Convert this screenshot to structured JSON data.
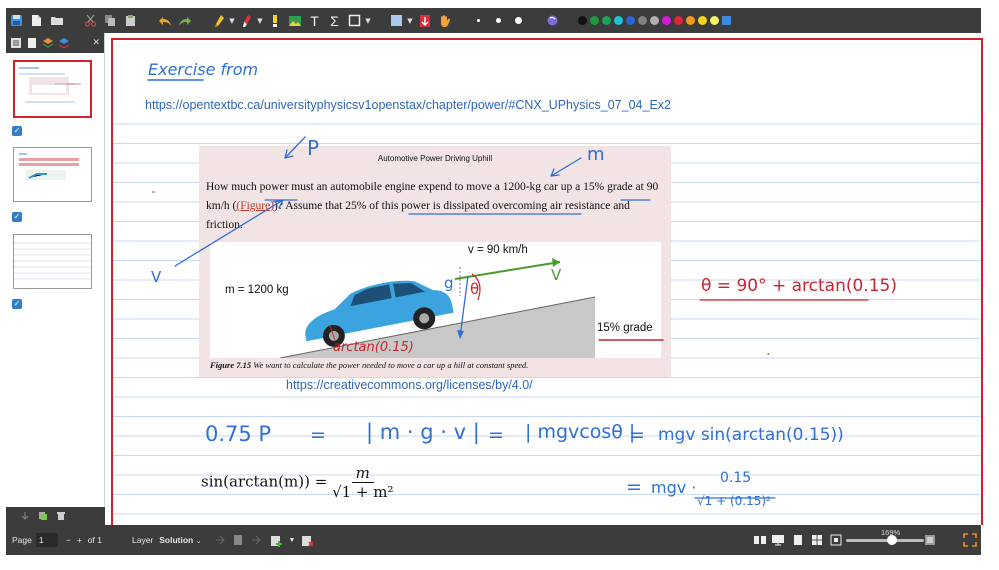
{
  "toolbar": {
    "icons": [
      "save-icon",
      "new-page-icon",
      "open-folder-icon",
      "cut-icon",
      "copy-icon",
      "paste-icon",
      "undo-icon",
      "redo-icon",
      "pen-icon",
      "highlighter-icon",
      "eraser-icon",
      "image-icon",
      "text-icon",
      "sigma-icon",
      "shape-icon",
      "fill-color-icon",
      "select-icon",
      "hand-icon",
      "dot-small-icon",
      "dot-medium-icon",
      "dot-large-icon",
      "eraser-round-icon"
    ],
    "text_tool_glyph": "T",
    "formula_tool_glyph": "Σ",
    "palette": [
      "#111111",
      "#1e9a3c",
      "#1aa35a",
      "#1ec3d8",
      "#2a67d6",
      "#808080",
      "#b0b0b0",
      "#d81ad8",
      "#e5243b",
      "#f29a1d",
      "#f5d51c",
      "#f6f06a",
      "#3c8be0"
    ]
  },
  "sidebar": {
    "pages": [
      {
        "label": "page-1",
        "selected": true,
        "checked": true
      },
      {
        "label": "page-2",
        "selected": false,
        "checked": true
      },
      {
        "label": "page-3",
        "selected": false,
        "checked": true
      }
    ]
  },
  "canvas": {
    "heading": "Exercise from",
    "source_url": "https://opentextbc.ca/universityphysicsv1openstax/chapter/power/#CNX_UPhysics_07_04_Ex2",
    "license_url": "https://creativecommons.org/licenses/by/4.0/",
    "problem": {
      "title": "Automotive Power Driving Uphill",
      "text_before_ref": "How much power must an automobile engine expend to move a 1200-kg car up a 15% grade at 90 km/h (",
      "ref": "(Figure)",
      "text_after_ref": ")? Assume that 25% of this power is dissipated overcoming air resistance and friction.",
      "fig_speed": "v = 90 km/h",
      "fig_mass": "m = 1200 kg",
      "fig_grade": "15% grade",
      "caption_label": "Figure 7.15",
      "caption_text": " We want to calculate the power needed to move a car up a hill at constant speed."
    },
    "annotations": {
      "p_label": "P",
      "m_label": "m",
      "v_label": "V",
      "v_fig_label": "V",
      "g_label": "g",
      "theta_label": "θ",
      "arctan_label": "arctan(0.15)",
      "theta_eq": "θ = 90° + arctan(0.15)",
      "eq_left": "0.75 P",
      "eq_eq1": "=",
      "eq_dot": "| m · g · v |",
      "eq_eq2": "=",
      "eq_abs": "| mgvcosθ |",
      "eq_eq3": "=",
      "eq_result": "mgv sin(arctan(0.15))",
      "eq_eq4": "=",
      "eq_final_prefix": "mgv ·",
      "eq_final_num": "0.15",
      "eq_final_den": "√1 + (0.15)²"
    },
    "math_identity": {
      "lhs": "sin(arctan(m)) =",
      "num": "m",
      "den": "√1 + m²"
    }
  },
  "statusbar": {
    "page_label": "Page",
    "page_value": "1",
    "page_minus": "−",
    "page_plus": "+",
    "of_label": "of 1",
    "layer_label": "Layer",
    "layer_value": "Solution",
    "zoom": "169%"
  }
}
